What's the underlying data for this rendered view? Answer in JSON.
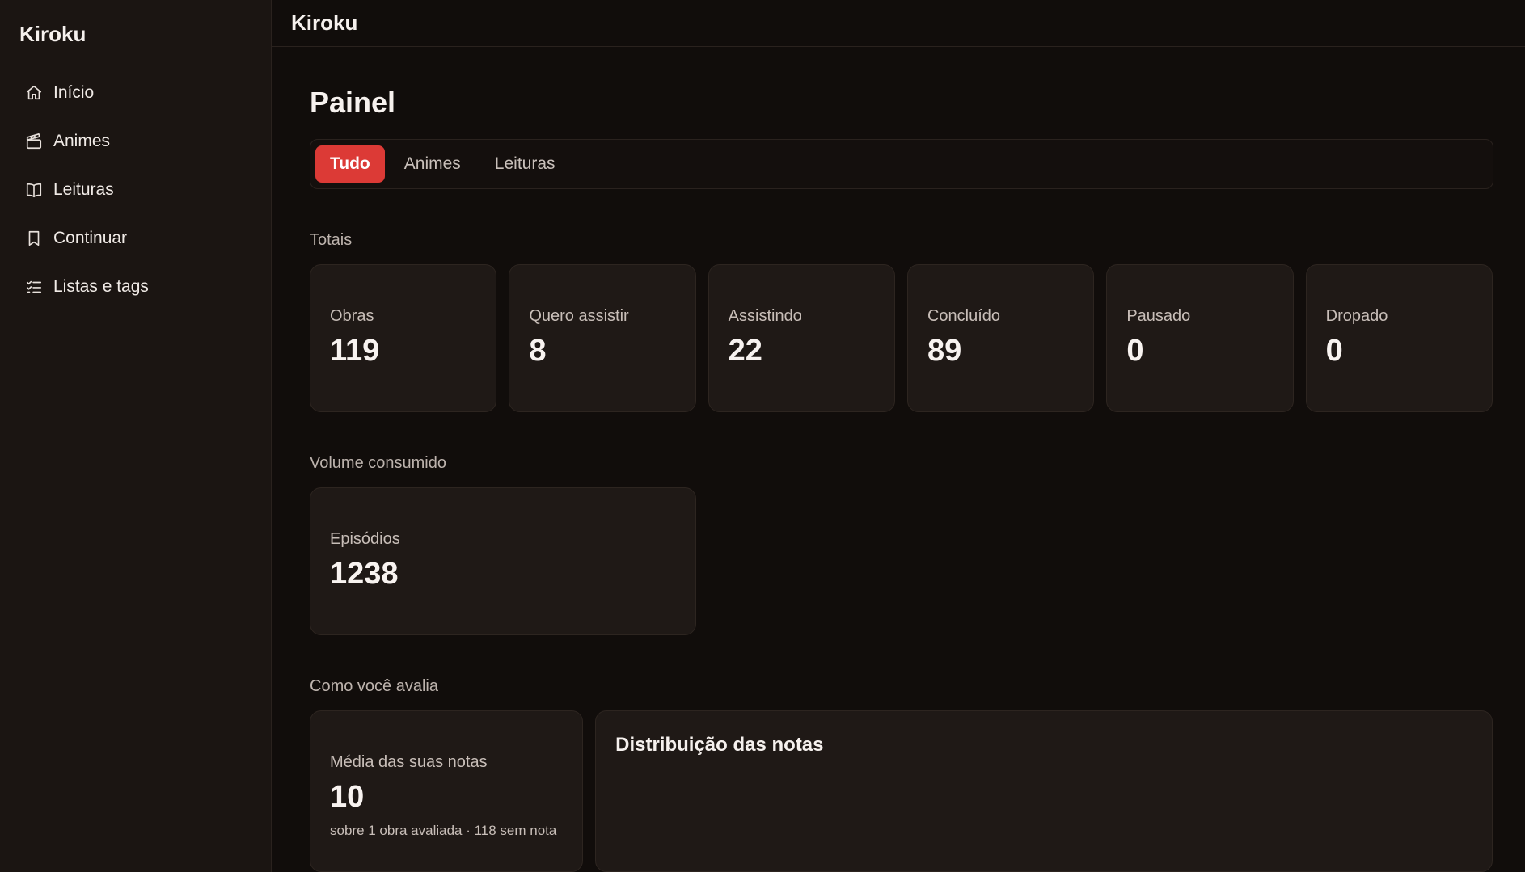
{
  "sidebar": {
    "brand": "Kiroku",
    "items": [
      {
        "label": "Início",
        "icon": "home-icon"
      },
      {
        "label": "Animes",
        "icon": "clapperboard-icon"
      },
      {
        "label": "Leituras",
        "icon": "book-icon"
      },
      {
        "label": "Continuar",
        "icon": "bookmark-icon"
      },
      {
        "label": "Listas e tags",
        "icon": "list-checks-icon"
      }
    ]
  },
  "header": {
    "title": "Kiroku"
  },
  "main": {
    "page_title": "Painel",
    "tabs": [
      {
        "label": "Tudo",
        "active": true
      },
      {
        "label": "Animes",
        "active": false
      },
      {
        "label": "Leituras",
        "active": false
      }
    ],
    "totals": {
      "title": "Totais",
      "cards": [
        {
          "label": "Obras",
          "value": "119"
        },
        {
          "label": "Quero assistir",
          "value": "8"
        },
        {
          "label": "Assistindo",
          "value": "22"
        },
        {
          "label": "Concluído",
          "value": "89"
        },
        {
          "label": "Pausado",
          "value": "0"
        },
        {
          "label": "Dropado",
          "value": "0"
        }
      ]
    },
    "volume": {
      "title": "Volume consumido",
      "card": {
        "label": "Episódios",
        "value": "1238"
      }
    },
    "rating": {
      "title": "Como você avalia",
      "average": {
        "label": "Média das suas notas",
        "value": "10",
        "sub": "sobre 1 obra avaliada · 118 sem nota"
      },
      "distribution_title": "Distribuição das notas"
    }
  },
  "colors": {
    "accent": "#dc3a36",
    "background": "#110d0b",
    "sidebar": "#1b1512",
    "card": "#1f1916"
  }
}
